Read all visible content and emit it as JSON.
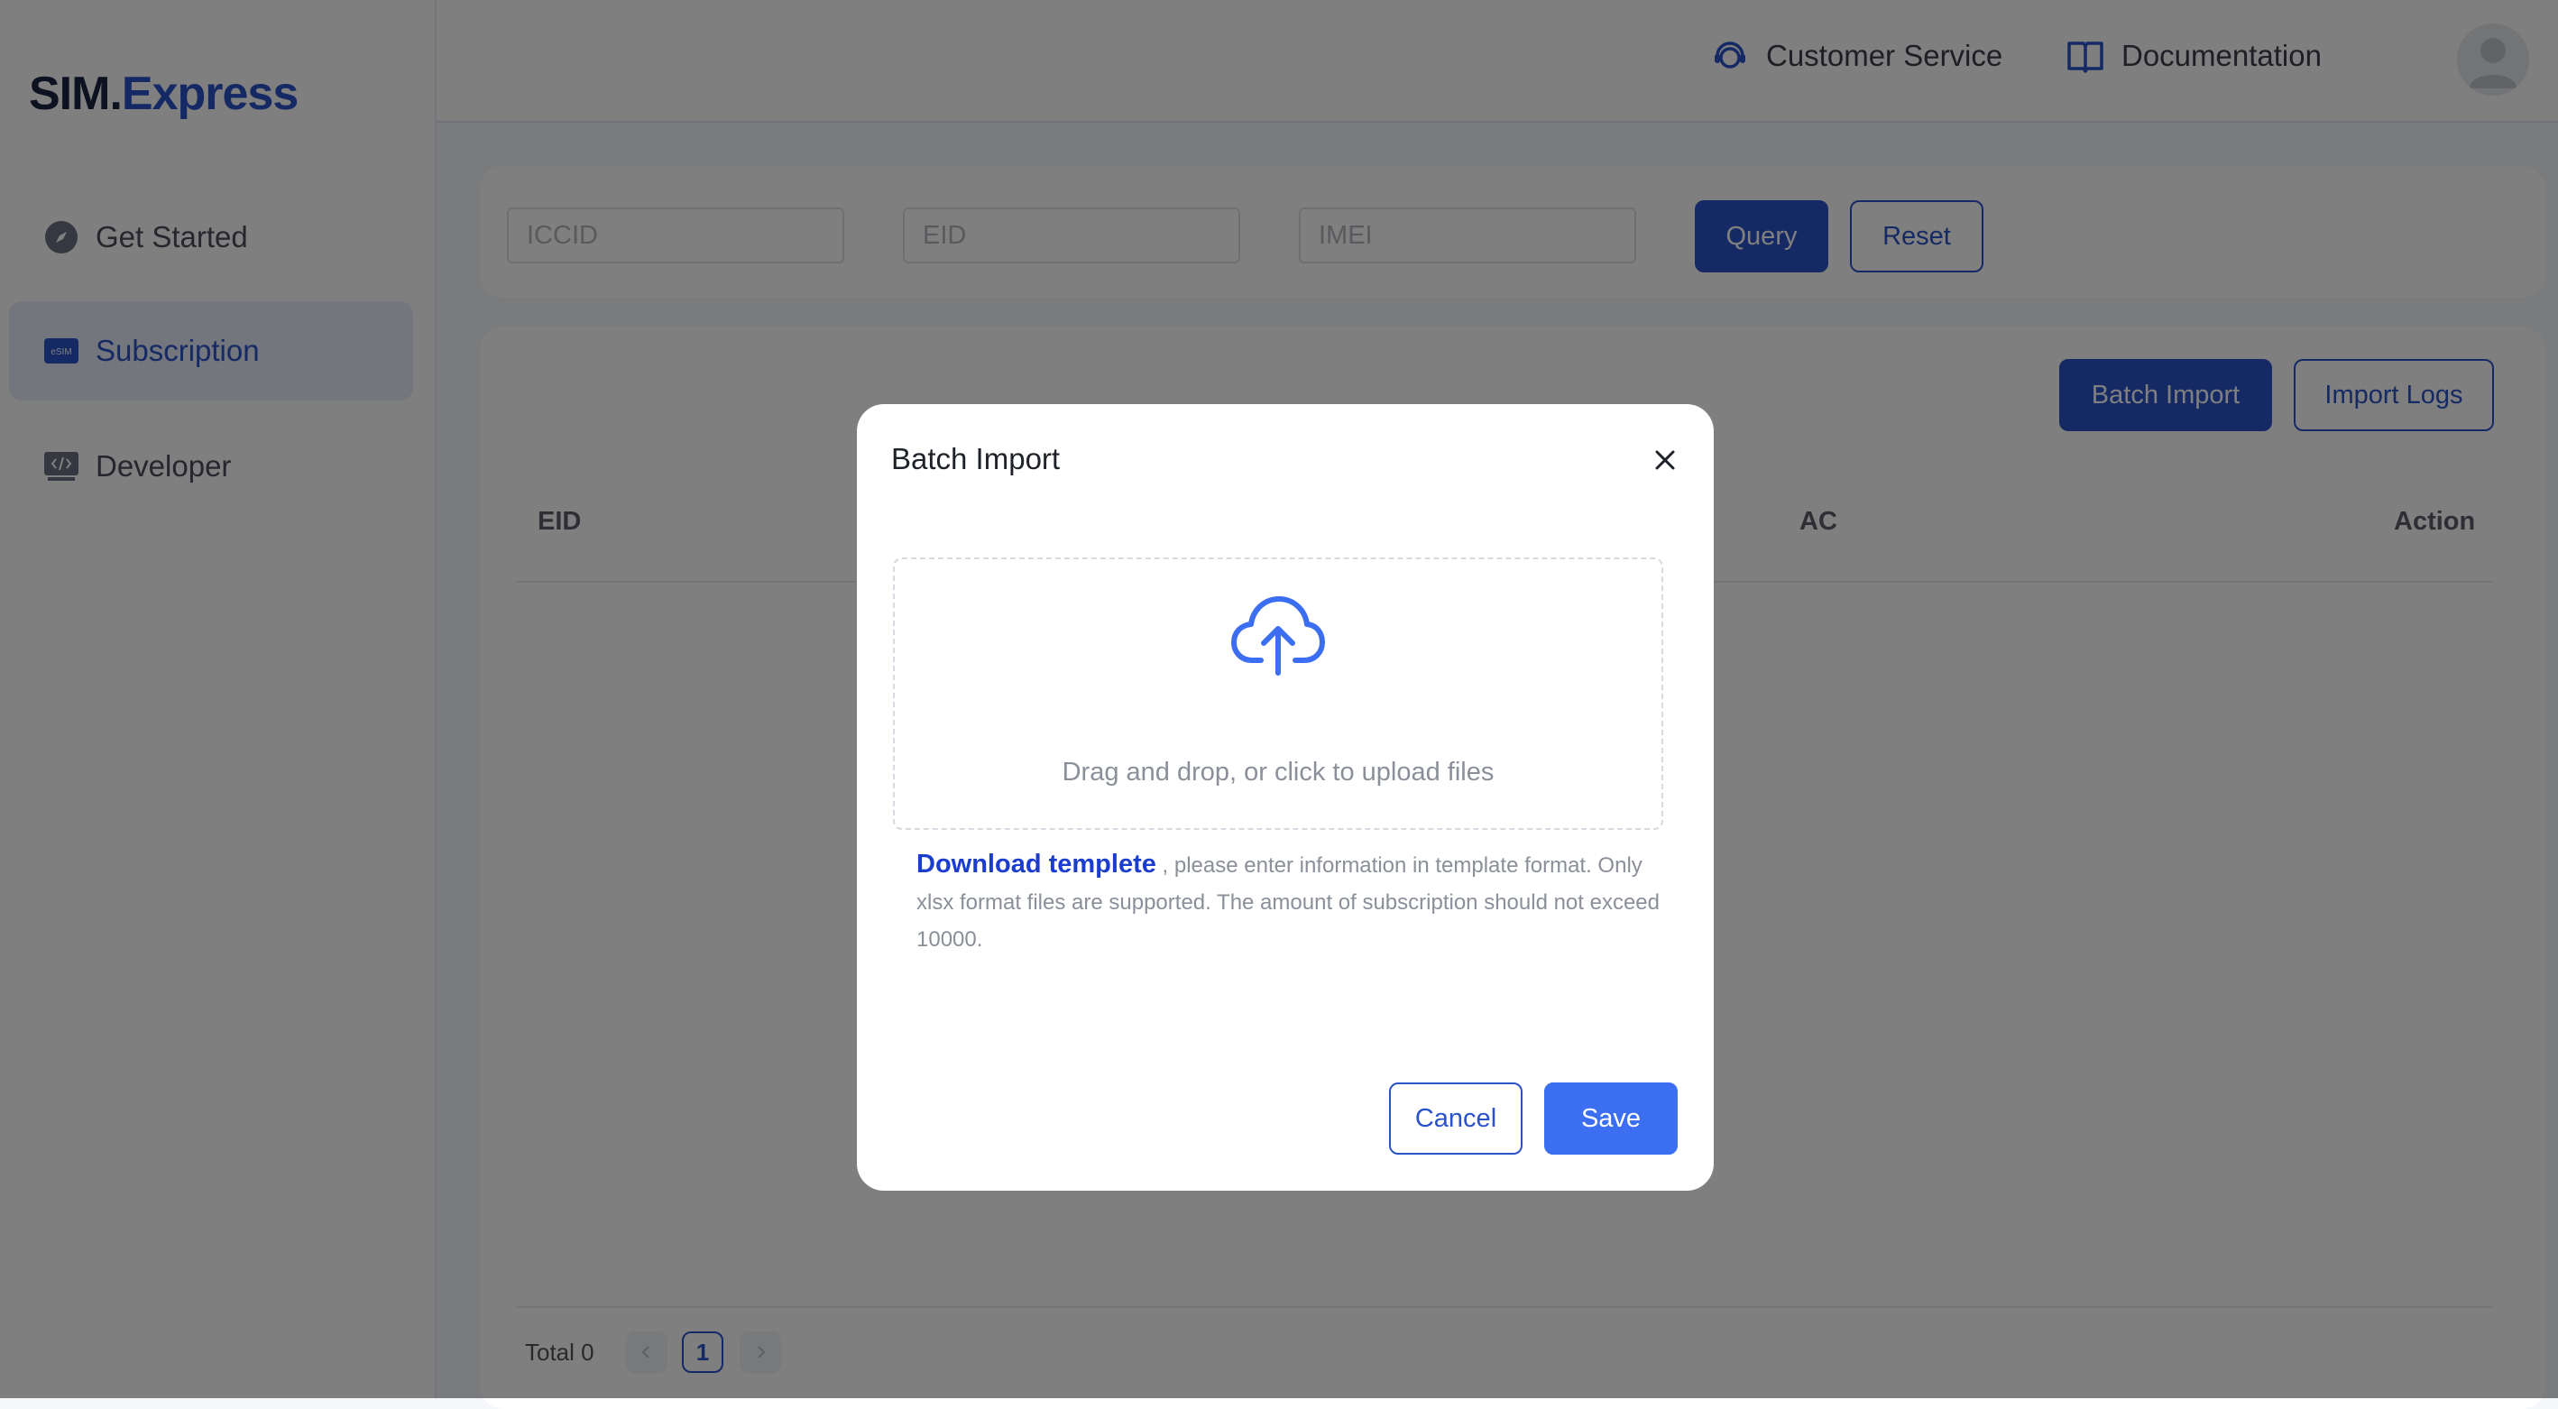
{
  "app": {
    "logo_part1": "SIM.",
    "logo_part2": "Express"
  },
  "sidebar": {
    "items": [
      {
        "label": "Get Started",
        "icon": "compass-icon"
      },
      {
        "label": "Subscription",
        "icon": "esim-icon",
        "icon_text": "eSIM"
      },
      {
        "label": "Developer",
        "icon": "code-icon"
      }
    ]
  },
  "header": {
    "customer_service": "Customer Service",
    "documentation": "Documentation"
  },
  "filters": {
    "iccid_placeholder": "ICCID",
    "eid_placeholder": "EID",
    "imei_placeholder": "IMEI",
    "query_label": "Query",
    "reset_label": "Reset"
  },
  "table": {
    "batch_import_label": "Batch Import",
    "import_logs_label": "Import Logs",
    "columns": [
      "EID",
      "AC",
      "Action"
    ],
    "total": "Total 0",
    "current_page": "1"
  },
  "modal": {
    "title": "Batch Import",
    "upload_text": "Drag and drop, or click to upload files",
    "download_link": "Download templete",
    "hint_text": " , please enter information in template format. Only xlsx format files are supported. The amount of subscription should not exceed 10000.",
    "cancel_label": "Cancel",
    "save_label": "Save"
  },
  "colors": {
    "primary": "#2b52c8",
    "save": "#3b6ef0",
    "link": "#1a3ccf",
    "upload_icon": "#3b6ef0"
  }
}
